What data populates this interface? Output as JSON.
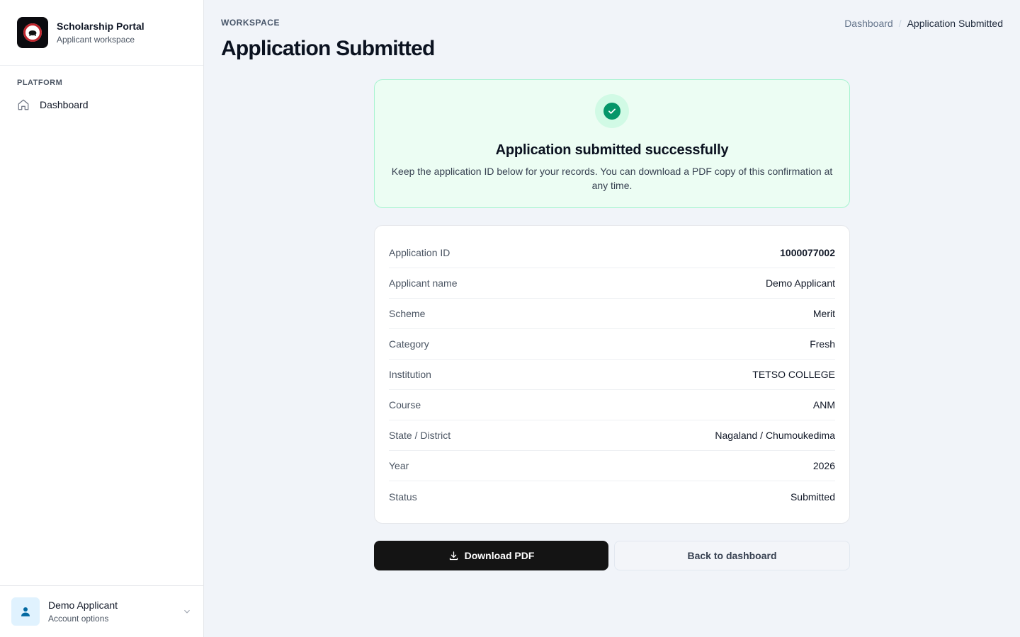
{
  "brand": {
    "title": "Scholarship Portal",
    "subtitle": "Applicant workspace"
  },
  "nav": {
    "heading": "PLATFORM",
    "items": [
      {
        "label": "Dashboard",
        "icon": "home-icon"
      }
    ]
  },
  "account": {
    "name": "Demo Applicant",
    "subtitle": "Account options"
  },
  "header": {
    "eyebrow": "WORKSPACE",
    "title": "Application Submitted",
    "breadcrumb": {
      "parent": "Dashboard",
      "separator": "/",
      "current": "Application Submitted"
    }
  },
  "success": {
    "title": "Application submitted successfully",
    "message": "Keep the application ID below for your records. You can download a PDF copy of this confirmation at any time."
  },
  "details": [
    {
      "label": "Application ID",
      "value": "1000077002"
    },
    {
      "label": "Applicant name",
      "value": "Demo Applicant"
    },
    {
      "label": "Scheme",
      "value": "Merit"
    },
    {
      "label": "Category",
      "value": "Fresh"
    },
    {
      "label": "Institution",
      "value": "TETSO COLLEGE"
    },
    {
      "label": "Course",
      "value": "ANM"
    },
    {
      "label": "State / District",
      "value": "Nagaland / Chumoukedima"
    },
    {
      "label": "Year",
      "value": "2026"
    },
    {
      "label": "Status",
      "value": "Submitted"
    }
  ],
  "actions": {
    "download_label": "Download PDF",
    "back_label": "Back to dashboard"
  },
  "colors": {
    "accent": "#059669",
    "success_bg": "#ecfdf3",
    "success_border": "#a7f3d0",
    "primary_button": "#141414",
    "page_bg": "#f1f4f9"
  }
}
